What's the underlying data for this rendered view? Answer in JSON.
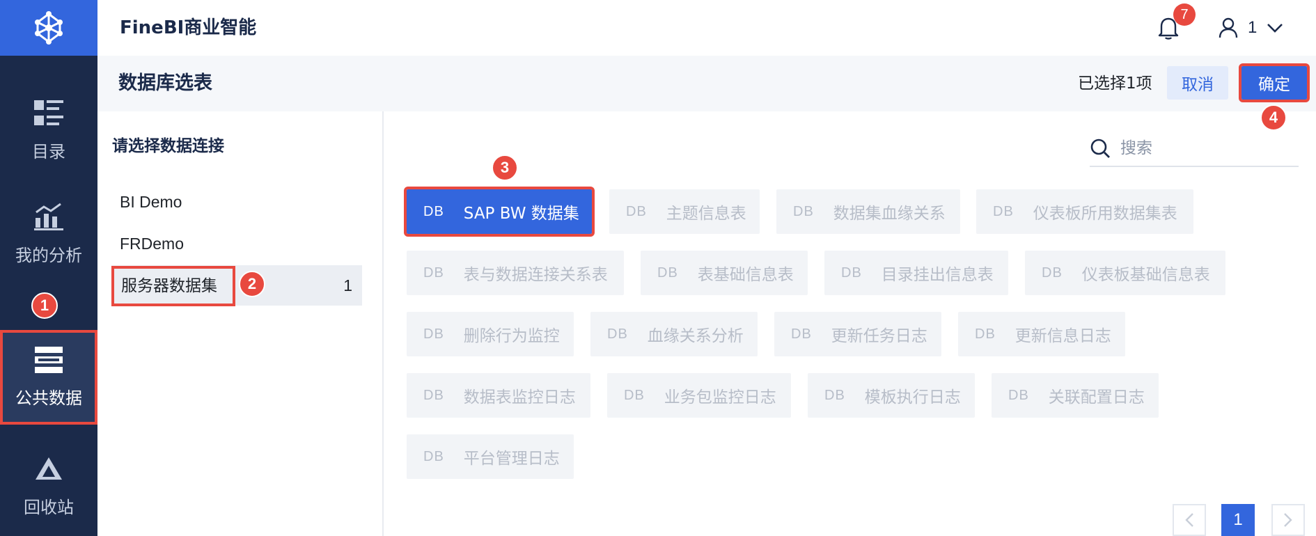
{
  "app": {
    "title": "FineBI商业智能"
  },
  "nav": {
    "items": [
      {
        "label": "目录",
        "icon": "catalog-icon"
      },
      {
        "label": "我的分析",
        "icon": "analysis-chart-icon"
      },
      {
        "label": "公共数据",
        "icon": "public-data-icon",
        "active": true
      },
      {
        "label": "回收站",
        "icon": "recycle-bin-icon"
      }
    ]
  },
  "header": {
    "notification_count": "7",
    "user_name": "1"
  },
  "page": {
    "title": "数据库选表",
    "selected_text": "已选择1项",
    "cancel_label": "取消",
    "confirm_label": "确定"
  },
  "connections": {
    "heading": "请选择数据连接",
    "items": [
      {
        "name": "BI Demo"
      },
      {
        "name": "FRDemo"
      },
      {
        "name": "服务器数据集",
        "count": "1",
        "active": true
      }
    ]
  },
  "search": {
    "placeholder": "搜索"
  },
  "tables": {
    "db_tag": "DB",
    "items": [
      {
        "name": "SAP BW 数据集",
        "selected": true
      },
      {
        "name": "主题信息表"
      },
      {
        "name": "数据集血缘关系"
      },
      {
        "name": "仪表板所用数据集表"
      },
      {
        "name": "表与数据连接关系表"
      },
      {
        "name": "表基础信息表"
      },
      {
        "name": "目录挂出信息表"
      },
      {
        "name": "仪表板基础信息表"
      },
      {
        "name": "删除行为监控"
      },
      {
        "name": "血缘关系分析"
      },
      {
        "name": "更新任务日志"
      },
      {
        "name": "更新信息日志"
      },
      {
        "name": "数据表监控日志"
      },
      {
        "name": "业务包监控日志"
      },
      {
        "name": "模板执行日志"
      },
      {
        "name": "关联配置日志"
      },
      {
        "name": "平台管理日志"
      }
    ]
  },
  "pagination": {
    "current": "1"
  },
  "annotations": [
    "1",
    "2",
    "3",
    "4"
  ],
  "colors": {
    "accent": "#3366dd",
    "nav_bg": "#1b2a4a",
    "highlight": "#e8493f"
  }
}
